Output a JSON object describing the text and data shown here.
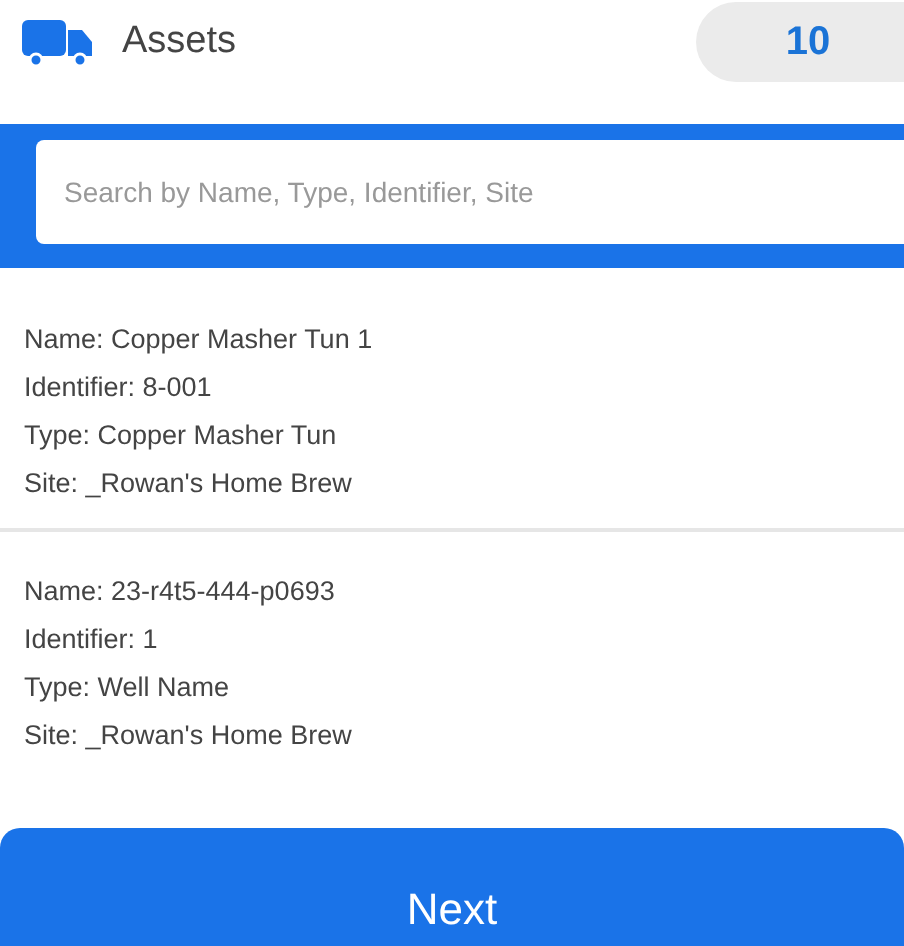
{
  "header": {
    "title": "Assets",
    "count": "10"
  },
  "search": {
    "placeholder": "Search by Name, Type, Identifier, Site"
  },
  "assets": [
    {
      "lines": [
        "Name: Copper Masher Tun 1",
        "Identifier: 8-001",
        "Type: Copper Masher Tun",
        "Site: _Rowan's Home Brew"
      ]
    },
    {
      "lines": [
        "Name: 23-r4t5-444-p0693",
        "Identifier: 1",
        "Type: Well Name",
        "Site: _Rowan's Home Brew"
      ]
    }
  ],
  "buttons": [
    "Next"
  ]
}
